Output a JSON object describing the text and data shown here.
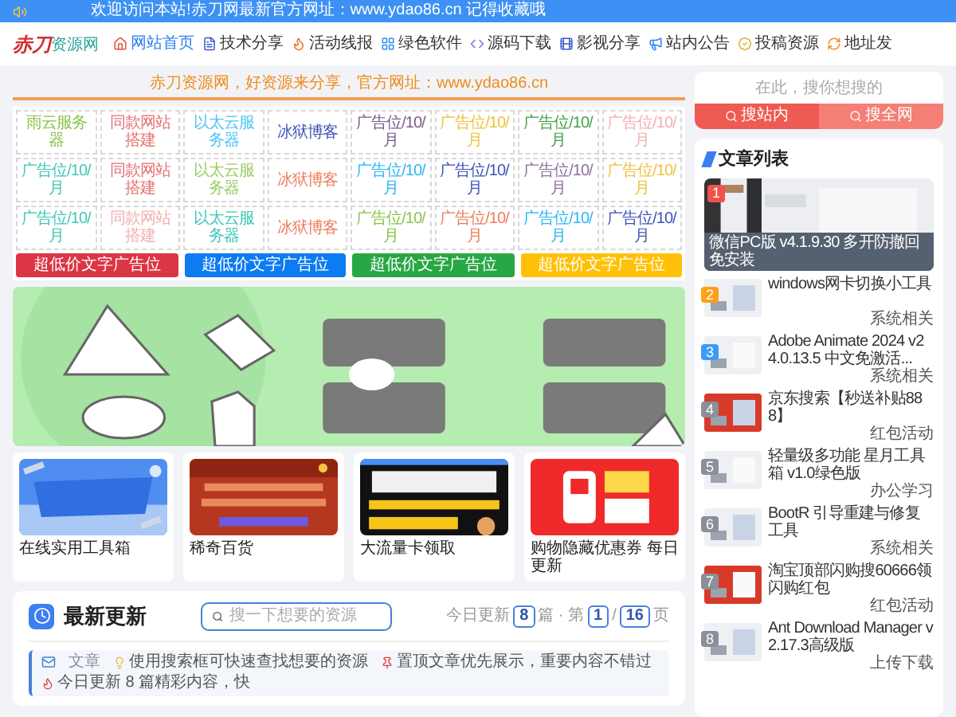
{
  "top_bar": {
    "text": "欢迎访问本站!赤刀网最新官方网址：www.ydao86.cn 记得收藏哦"
  },
  "logo": {
    "text": "赤刀",
    "suffix": "资源网"
  },
  "nav": [
    {
      "label": "网站首页",
      "selected": true
    },
    {
      "label": "技术分享",
      "selected": false
    },
    {
      "label": "活动线报",
      "selected": false
    },
    {
      "label": "绿色软件",
      "selected": false
    },
    {
      "label": "源码下载",
      "selected": false
    },
    {
      "label": "影视分享",
      "selected": false
    },
    {
      "label": "站内公告",
      "selected": false
    },
    {
      "label": "投稿资源",
      "selected": false
    },
    {
      "label": "地址发",
      "selected": false
    }
  ],
  "slogan": "赤刀资源网，好资源来分享，官方网址：www.ydao86.cn",
  "ad_cells": [
    {
      "text": "雨云服务器",
      "color": "#8bc34a"
    },
    {
      "text": "同款网站搭建",
      "color": "#e57373"
    },
    {
      "text": "以太云服务器",
      "color": "#4fc3f7"
    },
    {
      "text": "冰狱博客",
      "color": "#3f51b5"
    },
    {
      "text": "广告位/10/月",
      "color": "#7b5a8c"
    },
    {
      "text": "广告位/10/月",
      "color": "#f0c23a"
    },
    {
      "text": "广告位/10/月",
      "color": "#43a047"
    },
    {
      "text": "广告位/10/月",
      "color": "#f4b0b0"
    },
    {
      "text": "广告位/10/月",
      "color": "#3cc8b8"
    },
    {
      "text": "同款网站搭建",
      "color": "#e57373"
    },
    {
      "text": "以太云服务器",
      "color": "#9ccc65"
    },
    {
      "text": "冰狱博客",
      "color": "#ef7b5a"
    },
    {
      "text": "广告位/10/月",
      "color": "#29b6f6"
    },
    {
      "text": "广告位/10/月",
      "color": "#3f51b5"
    },
    {
      "text": "广告位/10/月",
      "color": "#8d6e9b"
    },
    {
      "text": "广告位/10/月",
      "color": "#f0c23a"
    },
    {
      "text": "广告位/10/月",
      "color": "#3cc8b8"
    },
    {
      "text": "同款网站搭建",
      "color": "#f4b0b0"
    },
    {
      "text": "以太云服务器",
      "color": "#3cc8b8"
    },
    {
      "text": "冰狱博客",
      "color": "#ef7b5a"
    },
    {
      "text": "广告位/10/月",
      "color": "#8bc34a"
    },
    {
      "text": "广告位/10/月",
      "color": "#ef7b5a"
    },
    {
      "text": "广告位/10/月",
      "color": "#29b6f6"
    },
    {
      "text": "广告位/10/月",
      "color": "#3f51b5"
    }
  ],
  "ad_buttons": [
    {
      "text": "超低价文字广告位",
      "color": "#dc3545"
    },
    {
      "text": "超低价文字广告位",
      "color": "#0d7bf2"
    },
    {
      "text": "超低价文字广告位",
      "color": "#28a745"
    },
    {
      "text": "超低价文字广告位",
      "color": "#ffc107"
    }
  ],
  "cards": [
    {
      "caption": "在线实用工具箱"
    },
    {
      "caption": "稀奇百货"
    },
    {
      "caption": "大流量卡领取"
    },
    {
      "caption": "购物隐藏优惠券 每日更新"
    }
  ],
  "latest": {
    "title": "最新更新",
    "search": {
      "placeholder": "搜一下想要的资源"
    },
    "stats": {
      "today_label": "今日更新",
      "today_count": "8",
      "middle": "篇 · 第",
      "page": "1",
      "separator": "/",
      "total": "16",
      "end": "页"
    },
    "notice": {
      "lead": "文章",
      "messages": [
        "使用搜索框可快速查找想要的资源",
        "置顶文章优先展示，重要内容不错过",
        "今日更新 8 篇精彩内容，快"
      ]
    }
  },
  "search": {
    "placeholder": "在此，搜你想搜的",
    "buttons": [
      "搜站内",
      "搜全网"
    ]
  },
  "articles": {
    "title": "文章列表",
    "featured": {
      "rank": "1",
      "color": "#f0524a",
      "title": "微信PC版 v4.1.9.30 多开防撤回免安装"
    },
    "items": [
      {
        "rank": "2",
        "color": "#ff9f1a",
        "title": "windows网卡切换小工具",
        "category": "系统相关"
      },
      {
        "rank": "3",
        "color": "#3b9cf5",
        "title": "Adobe Animate 2024 v24.0.13.5 中文免激活...",
        "category": "系统相关"
      },
      {
        "rank": "4",
        "color": "#8a8f99",
        "title": "京东搜索【秒送补贴888】",
        "category": "红包活动"
      },
      {
        "rank": "5",
        "color": "#8a8f99",
        "title": "轻量级多功能 星月工具箱 v1.0绿色版",
        "category": "办公学习"
      },
      {
        "rank": "6",
        "color": "#8a8f99",
        "title": "BootR 引导重建与修复工具",
        "category": "系统相关"
      },
      {
        "rank": "7",
        "color": "#8a8f99",
        "title": "淘宝顶部闪购搜60666领闪购红包",
        "category": "红包活动"
      },
      {
        "rank": "8",
        "color": "#8a8f99",
        "title": "Ant Download Manager v2.17.3高级版",
        "category": "上传下载"
      }
    ]
  }
}
